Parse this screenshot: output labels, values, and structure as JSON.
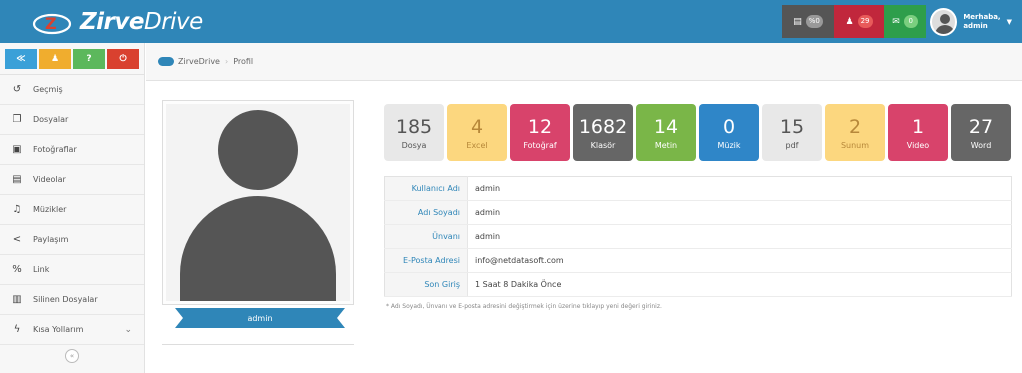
{
  "app": {
    "logo_bold": "Zirve",
    "logo_light": "Drive"
  },
  "topbar": {
    "files_badge": "%0",
    "notif_badge": "29",
    "mail_badge": "0",
    "user_greeting": "Merhaba,",
    "user_name": "admin",
    "colors": {
      "bar": "#2f86b8",
      "dark": "#555555",
      "red": "#c1273c",
      "green": "#2e9e4b"
    }
  },
  "sidebar": {
    "buttons": [
      {
        "icon": "share-icon",
        "glyph": "≪",
        "color": "#3aa0d8"
      },
      {
        "icon": "user-icon",
        "glyph": "♟",
        "color": "#f0ad2e"
      },
      {
        "icon": "help-icon",
        "glyph": "?",
        "color": "#5cb85c"
      },
      {
        "icon": "power-icon",
        "glyph": "⏻",
        "color": "#d9412f"
      }
    ],
    "items": [
      {
        "label": "Geçmiş",
        "icon": "history-icon",
        "glyph": "↺"
      },
      {
        "label": "Dosyalar",
        "icon": "files-icon",
        "glyph": "❐"
      },
      {
        "label": "Fotoğraflar",
        "icon": "photo-icon",
        "glyph": "▣"
      },
      {
        "label": "Videolar",
        "icon": "video-icon",
        "glyph": "▤"
      },
      {
        "label": "Müzikler",
        "icon": "music-icon",
        "glyph": "♫"
      },
      {
        "label": "Paylaşım",
        "icon": "share-icon",
        "glyph": "<"
      },
      {
        "label": "Link",
        "icon": "link-icon",
        "glyph": "%"
      },
      {
        "label": "Silinen Dosyalar",
        "icon": "trash-icon",
        "glyph": "▥"
      },
      {
        "label": "Kısa Yollarım",
        "icon": "bolt-icon",
        "glyph": "ϟ"
      }
    ],
    "collapse_glyph": "«"
  },
  "breadcrumb": {
    "root": "ZirveDrive",
    "current": "Profil"
  },
  "profile": {
    "name": "admin"
  },
  "stats": [
    {
      "value": "185",
      "label": "Dosya",
      "bg": "#e8e8e8",
      "fg": "#555555"
    },
    {
      "value": "4",
      "label": "Excel",
      "bg": "#fcd77f",
      "fg": "#b7883a"
    },
    {
      "value": "12",
      "label": "Fotoğraf",
      "bg": "#d8436b",
      "fg": "#ffffff"
    },
    {
      "value": "1682",
      "label": "Klasör",
      "bg": "#666666",
      "fg": "#ffffff"
    },
    {
      "value": "14",
      "label": "Metin",
      "bg": "#7ab648",
      "fg": "#ffffff"
    },
    {
      "value": "0",
      "label": "Müzik",
      "bg": "#2f86c8",
      "fg": "#ffffff"
    },
    {
      "value": "15",
      "label": "pdf",
      "bg": "#e8e8e8",
      "fg": "#555555"
    },
    {
      "value": "2",
      "label": "Sunum",
      "bg": "#fcd77f",
      "fg": "#b7883a"
    },
    {
      "value": "1",
      "label": "Video",
      "bg": "#d8436b",
      "fg": "#ffffff"
    },
    {
      "value": "27",
      "label": "Word",
      "bg": "#666666",
      "fg": "#ffffff"
    }
  ],
  "info": [
    {
      "key": "Kullanıcı Adı",
      "value": "admin"
    },
    {
      "key": "Adı Soyadı",
      "value": "admin"
    },
    {
      "key": "Ünvanı",
      "value": "admin"
    },
    {
      "key": "E-Posta Adresi",
      "value": "info@netdatasoft.com"
    },
    {
      "key": "Son Giriş",
      "value": "1 Saat 8 Dakika Önce"
    }
  ],
  "note": "* Adı Soyadı, Ünvanı ve E-posta adresini değiştirmek için üzerine tıklayıp yeni değeri giriniz."
}
